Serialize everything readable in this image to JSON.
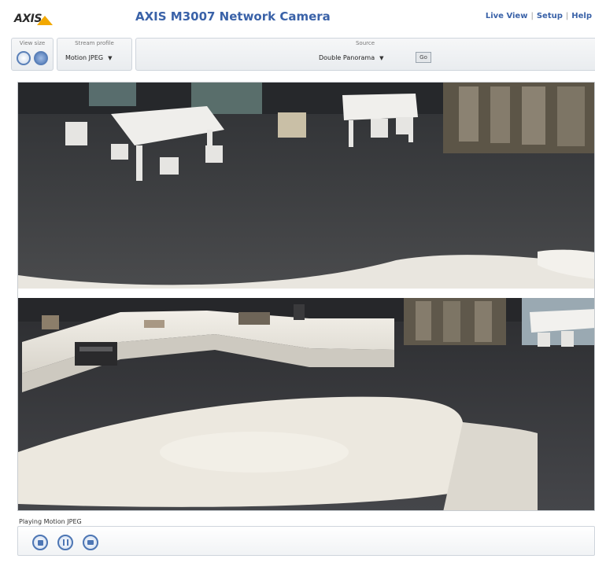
{
  "header": {
    "logo_text": "AXIS",
    "title": "AXIS M3007 Network Camera",
    "nav": [
      {
        "label": "Live View"
      },
      {
        "label": "Setup"
      },
      {
        "label": "Help"
      }
    ]
  },
  "toolbar": {
    "view_size_label": "View size",
    "stream_profile_label": "Stream profile",
    "stream_profile_value": "Motion JPEG",
    "source_label": "Source",
    "source_value": "Double Panorama",
    "go_label": "Go"
  },
  "player": {
    "status_text": "Playing Motion JPEG"
  },
  "icons": {
    "view_size_small": "view-size-icon",
    "view_size_full": "fullscreen-icon",
    "stop": "stop-icon",
    "pause": "pause-icon",
    "snapshot": "snapshot-icon"
  },
  "colors": {
    "brand_blue": "#3a62a8",
    "logo_yellow": "#f2a800"
  }
}
